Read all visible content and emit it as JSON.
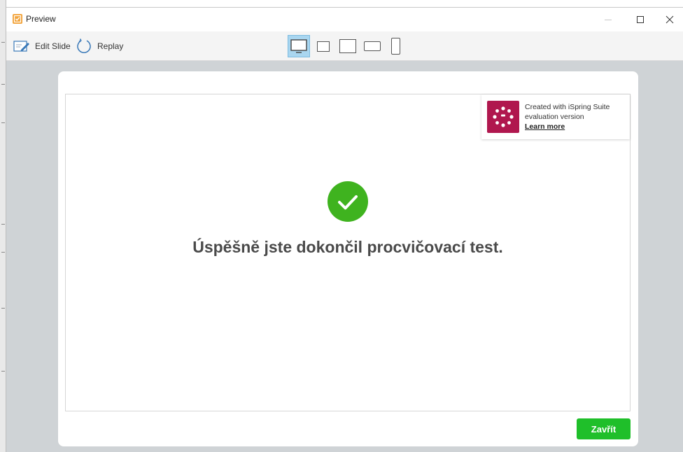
{
  "window": {
    "title": "Preview",
    "app_icon": "preview-icon",
    "controls": {
      "minimize_icon": "minimize-icon",
      "maximize_icon": "maximize-icon",
      "close_icon": "close-icon"
    }
  },
  "toolbar": {
    "edit_slide": {
      "label": "Edit Slide",
      "icon": "edit-slide-icon"
    },
    "replay": {
      "label": "Replay",
      "icon": "replay-icon"
    },
    "device_views": [
      {
        "icon": "desktop-icon",
        "active": true
      },
      {
        "icon": "tablet-landscape-small-icon",
        "active": false
      },
      {
        "icon": "tablet-portrait-icon",
        "active": false
      },
      {
        "icon": "tablet-landscape-icon",
        "active": false
      },
      {
        "icon": "phone-icon",
        "active": false
      }
    ]
  },
  "watermark": {
    "line1": "Created with iSpring Suite",
    "line2": "evaluation version",
    "link": "Learn more",
    "logo_color": "#b0174e"
  },
  "slide": {
    "success_icon": "checkmark-icon",
    "message": "Úspěšně jste dokončil procvičovací test."
  },
  "footer": {
    "close_label": "Zavřít"
  },
  "colors": {
    "accent_selected": "#a9d6f0",
    "success": "#3fb31f",
    "close_button": "#1fbf2a",
    "background": "#cfd3d6"
  }
}
